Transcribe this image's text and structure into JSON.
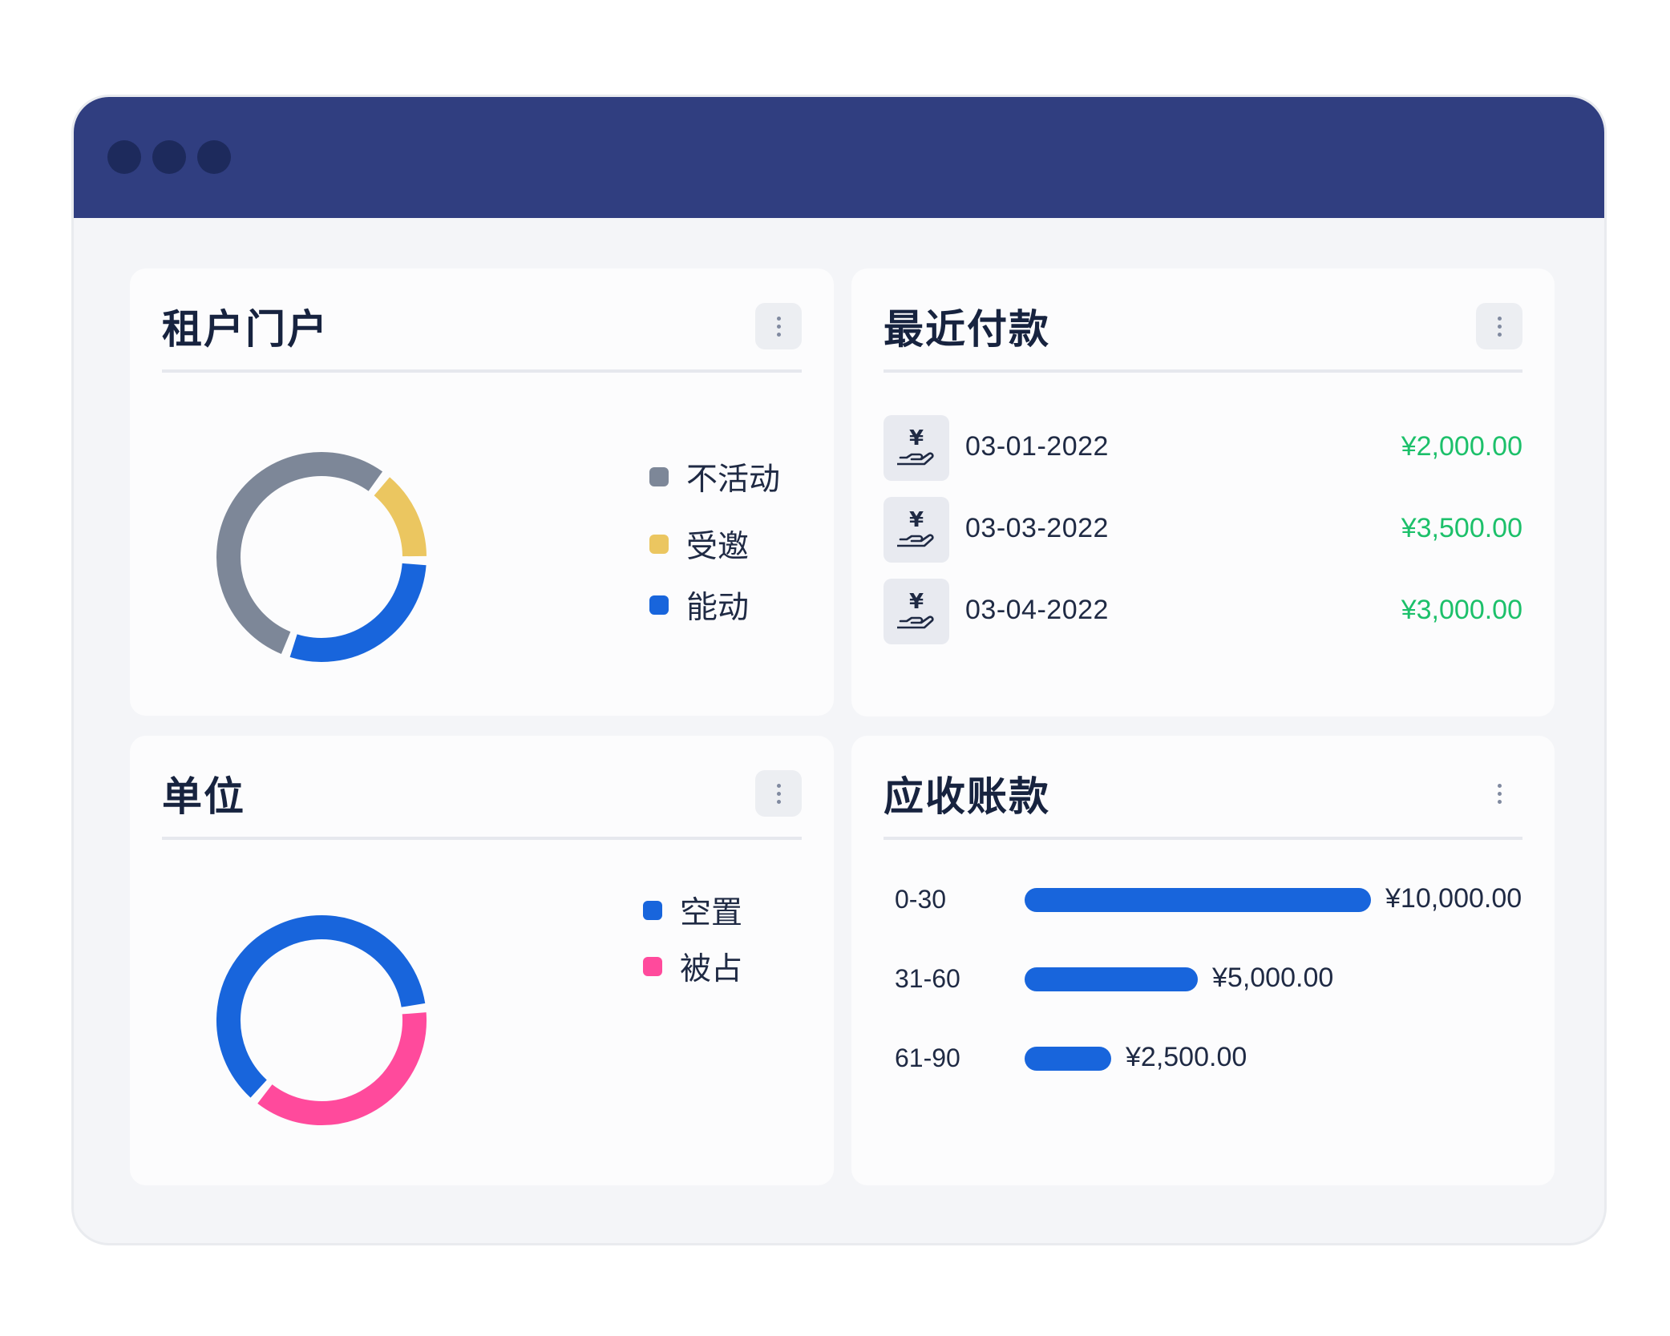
{
  "window": {
    "title_dots": 3
  },
  "tenant_portal": {
    "title": "租户门户",
    "legend": [
      {
        "label": "不活动",
        "color": "#7d8798"
      },
      {
        "label": "受邀",
        "color": "#ebc660"
      },
      {
        "label": "能动",
        "color": "#1865dc"
      }
    ],
    "menu_icon": "more-vertical-icon"
  },
  "units": {
    "title": "单位",
    "legend": [
      {
        "label": "空置",
        "color": "#1865dc"
      },
      {
        "label": "被占",
        "color": "#ff4a9c"
      }
    ],
    "menu_icon": "more-vertical-icon"
  },
  "recent_payments": {
    "title": "最近付款",
    "rows": [
      {
        "icon": "yen-hand-icon",
        "date": "03-01-2022",
        "amount": "¥2,000.00"
      },
      {
        "icon": "yen-hand-icon",
        "date": "03-03-2022",
        "amount": "¥3,500.00"
      },
      {
        "icon": "yen-hand-icon",
        "date": "03-04-2022",
        "amount": "¥3,000.00"
      }
    ],
    "amount_color": "#1cc06a",
    "menu_icon": "more-vertical-icon"
  },
  "receivables": {
    "title": "应收账款",
    "rows": [
      {
        "range": "0-30",
        "value": "¥10,000.00"
      },
      {
        "range": "31-60",
        "value": "¥5,000.00"
      },
      {
        "range": "61-90",
        "value": "¥2,500.00"
      }
    ],
    "bar_color": "#1865dc",
    "menu_icon": "more-vertical-icon"
  },
  "chart_data": [
    {
      "type": "pie",
      "title": "租户门户",
      "categories": [
        "不活动",
        "受邀",
        "能动"
      ],
      "values": [
        55,
        15,
        30
      ],
      "colors": [
        "#7d8798",
        "#ebc660",
        "#1865dc"
      ]
    },
    {
      "type": "pie",
      "title": "单位",
      "categories": [
        "空置",
        "被占"
      ],
      "values": [
        62,
        38
      ],
      "colors": [
        "#1865dc",
        "#ff4a9c"
      ]
    },
    {
      "type": "bar",
      "title": "应收账款",
      "categories": [
        "0-30",
        "31-60",
        "61-90"
      ],
      "values": [
        10000,
        5000,
        2500
      ]
    }
  ]
}
